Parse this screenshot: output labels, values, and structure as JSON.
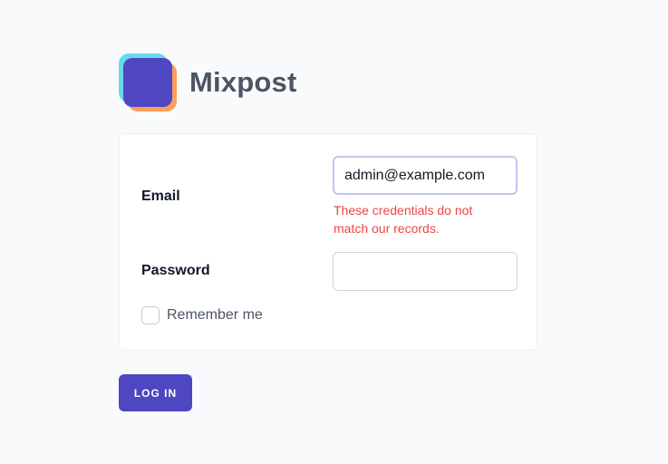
{
  "brand": {
    "name": "Mixpost",
    "colors": {
      "primary": "#4f46c1",
      "cyan": "#67d9ec",
      "orange": "#fb9e5a"
    }
  },
  "form": {
    "email": {
      "label": "Email",
      "value": "admin@example.com",
      "error": "These credentials do not match our records."
    },
    "password": {
      "label": "Password",
      "value": ""
    },
    "remember": {
      "label": "Remember me",
      "checked": false
    },
    "submit_label": "LOG IN"
  },
  "colors": {
    "background": "#f9fafb",
    "error": "#ef4444"
  }
}
